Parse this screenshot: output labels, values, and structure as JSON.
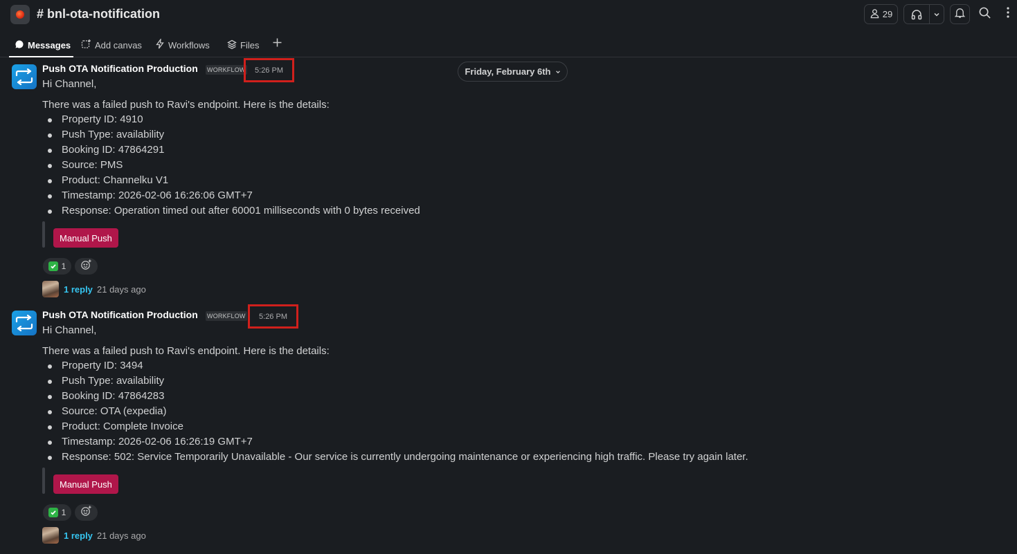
{
  "channel": {
    "name": "# bnl-ota-notification",
    "member_count": "29"
  },
  "tabs": [
    {
      "label": "Messages",
      "icon": "message-bubble-icon"
    },
    {
      "label": "Add canvas",
      "icon": "canvas-icon"
    },
    {
      "label": "Workflows",
      "icon": "lightning-icon"
    },
    {
      "label": "Files",
      "icon": "stack-icon"
    }
  ],
  "date_divider": "Friday, February 6th",
  "messages": [
    {
      "sender": "Push OTA Notification Production",
      "badge": "WORKFLOW",
      "time": "5:26 PM",
      "greeting": "Hi Channel,",
      "intro": "There was a failed push to Ravi's endpoint. Here is the details:",
      "details": [
        "Property ID: 4910",
        "Push Type: availability",
        "Booking ID: 47864291",
        "Source: PMS",
        "Product: Channelku V1",
        "Timestamp: 2026-02-06 16:26:06 GMT+7",
        "Response: Operation timed out after 60001 milliseconds with 0 bytes received"
      ],
      "button_label": "Manual Push",
      "reaction_count": "1",
      "reply_label": "1 reply",
      "reply_time": "21 days ago"
    },
    {
      "sender": "Push OTA Notification Production",
      "badge": "WORKFLOW",
      "time": "5:26 PM",
      "greeting": "Hi Channel,",
      "intro": "There was a failed push to Ravi's endpoint. Here is the details:",
      "details": [
        "Property ID: 3494",
        "Push Type: availability",
        "Booking ID: 47864283",
        "Source: OTA (expedia)",
        "Product: Complete Invoice",
        "Timestamp: 2026-02-06 16:26:19 GMT+7",
        "Response: 502: Service Temporarily Unavailable - Our service is currently undergoing maintenance or experiencing high traffic. Please try again later."
      ],
      "button_label": "Manual Push",
      "reaction_count": "1",
      "reply_label": "1 reply",
      "reply_time": "21 days ago"
    }
  ],
  "colors": {
    "background": "#1a1d21",
    "button": "#b0164a",
    "link": "#36c5f0",
    "highlight_box": "#d0201c"
  }
}
